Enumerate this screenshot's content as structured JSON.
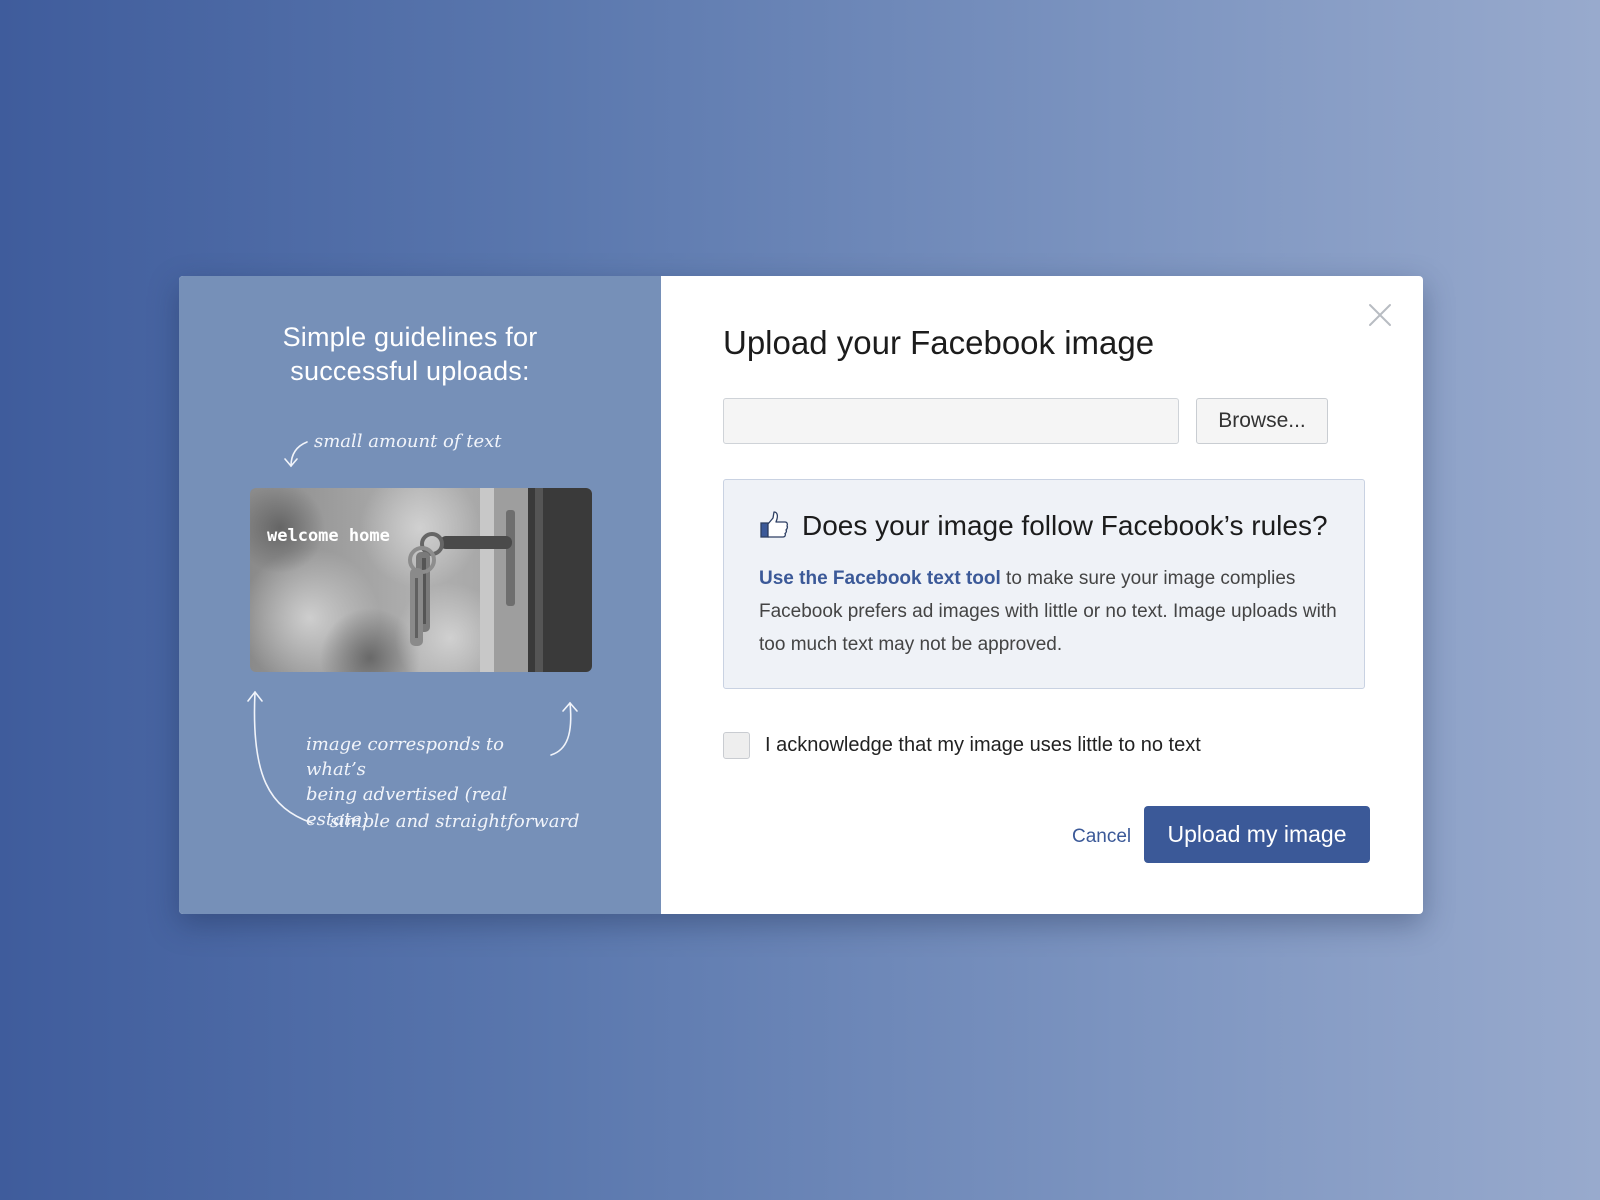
{
  "colors": {
    "brand": "#3b5998",
    "left_panel": "#7690b8",
    "info_box": "#eff2f7"
  },
  "left": {
    "title_line1": "Simple guidelines for",
    "title_line2": "successful uploads:",
    "annotations": {
      "text_amount": "small amount of text",
      "correspond_line1": "image corresponds to what’s",
      "correspond_line2": "being advertised (real estate)",
      "simple": "simple and straightforward"
    },
    "sample_image_caption": "welcome home"
  },
  "modal": {
    "heading": "Upload your Facebook image",
    "file_input_value": "",
    "browse_label": "Browse...",
    "rules": {
      "icon": "thumbs-up-icon",
      "title": "Does your image follow Facebook’s rules?",
      "link_text": "Use the Facebook text tool",
      "body_text": " to make sure your image complies Facebook prefers ad images with little or no text. Image uploads with too much text may not be approved."
    },
    "acknowledge_label": "I acknowledge that my image uses little to no text",
    "acknowledge_checked": false,
    "cancel_label": "Cancel",
    "upload_label": "Upload my image",
    "close_icon": "close-icon"
  }
}
